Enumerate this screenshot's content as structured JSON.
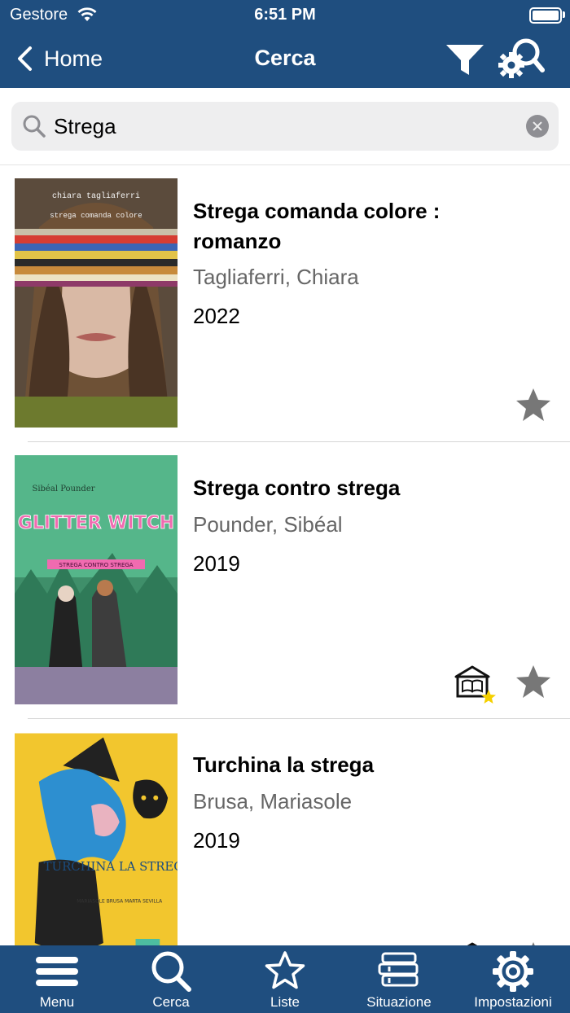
{
  "status_bar": {
    "carrier": "Gestore",
    "time": "6:51 PM"
  },
  "nav": {
    "back_label": "Home",
    "title": "Cerca"
  },
  "search": {
    "value": "Strega",
    "placeholder": ""
  },
  "results": [
    {
      "title": "Strega comanda colore : romanzo",
      "author": "Tagliaferri, Chiara",
      "year": "2022",
      "cover_text_top": "chiara tagliaferri",
      "cover_text_sub": "strega comanda colore",
      "cover_icon": "book-cover-image",
      "available_in_library": false,
      "favorite_icon": "star-icon"
    },
    {
      "title": "Strega contro strega",
      "author": "Pounder, Sibéal",
      "year": "2019",
      "cover_text_top": "Sibéal Pounder",
      "cover_text_main": "GLITTER WITCH",
      "cover_text_sub": "STREGA CONTRO STREGA",
      "cover_icon": "book-cover-image",
      "available_in_library": true,
      "library_icon": "library-star-icon",
      "favorite_icon": "star-icon"
    },
    {
      "title": "Turchina la strega",
      "author": "Brusa, Mariasole",
      "year": "2019",
      "cover_text_main": "TURCHINA LA STREGA",
      "cover_text_sub": "MARIASOLE BRUSA  MARTA SEVILLA",
      "cover_icon": "book-cover-image",
      "available_in_library": true,
      "favorite_icon": "star-icon"
    }
  ],
  "tabs": [
    {
      "label": "Menu",
      "icon": "menu-icon"
    },
    {
      "label": "Cerca",
      "icon": "search-icon"
    },
    {
      "label": "Liste",
      "icon": "star-outline-icon"
    },
    {
      "label": "Situazione",
      "icon": "books-icon"
    },
    {
      "label": "Impostazioni",
      "icon": "gear-icon"
    }
  ],
  "colors": {
    "nav_background": "#1f4e7f",
    "star_gray": "#777777",
    "library_star": "#f5d000"
  }
}
